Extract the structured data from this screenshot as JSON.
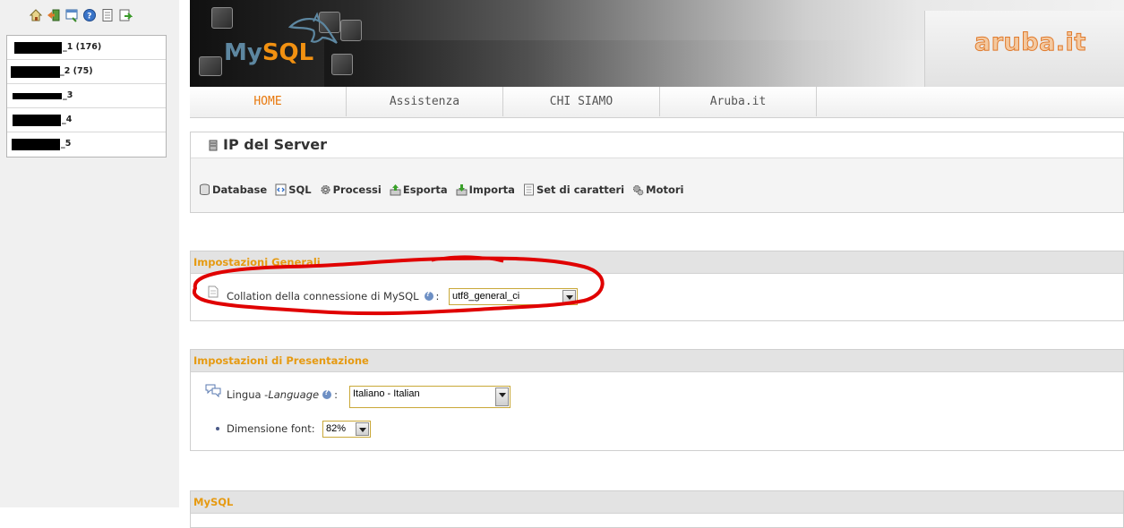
{
  "left_nav": {
    "icons": [
      "home-icon",
      "exit-icon",
      "query-window-icon",
      "help-icon",
      "documentation-icon",
      "refresh-icon"
    ],
    "databases": [
      {
        "label": "_1 (176)"
      },
      {
        "label": "_2 (75)"
      },
      {
        "label": "_3"
      },
      {
        "label": "_4"
      },
      {
        "label": "_5"
      }
    ]
  },
  "banner": {
    "mysql_logo": "MySQL",
    "aruba_logo": "aruba.it"
  },
  "menu": {
    "items": [
      "HOME",
      "Assistenza",
      "CHI SIAMO",
      "Aruba.it"
    ],
    "active_color": "#e8780c"
  },
  "server": {
    "title": "IP del Server",
    "tabs": [
      {
        "label": "Database",
        "icon": "database-icon"
      },
      {
        "label": "SQL",
        "icon": "sql-icon"
      },
      {
        "label": "Processi",
        "icon": "processes-icon"
      },
      {
        "label": "Esporta",
        "icon": "export-icon"
      },
      {
        "label": "Importa",
        "icon": "import-icon"
      },
      {
        "label": "Set di caratteri",
        "icon": "charset-icon"
      },
      {
        "label": "Motori",
        "icon": "engines-icon"
      }
    ]
  },
  "general_settings": {
    "title": "Impostazioni Generali",
    "collation_label": "Collation della connessione di MySQL",
    "colon": ":",
    "collation_value": "utf8_general_ci"
  },
  "presentation_settings": {
    "title": "Impostazioni di Presentazione",
    "language_label": "Lingua - ",
    "language_label_em": "Language",
    "colon": ":",
    "language_value": "Italiano - Italian",
    "font_size_label": "Dimensione font:",
    "font_size_value": "82%"
  },
  "mysql_section": {
    "title": "MySQL"
  },
  "colors": {
    "fieldset_title": "#e69a11",
    "annotation": "#e00000",
    "select_border": "#c9a838"
  }
}
